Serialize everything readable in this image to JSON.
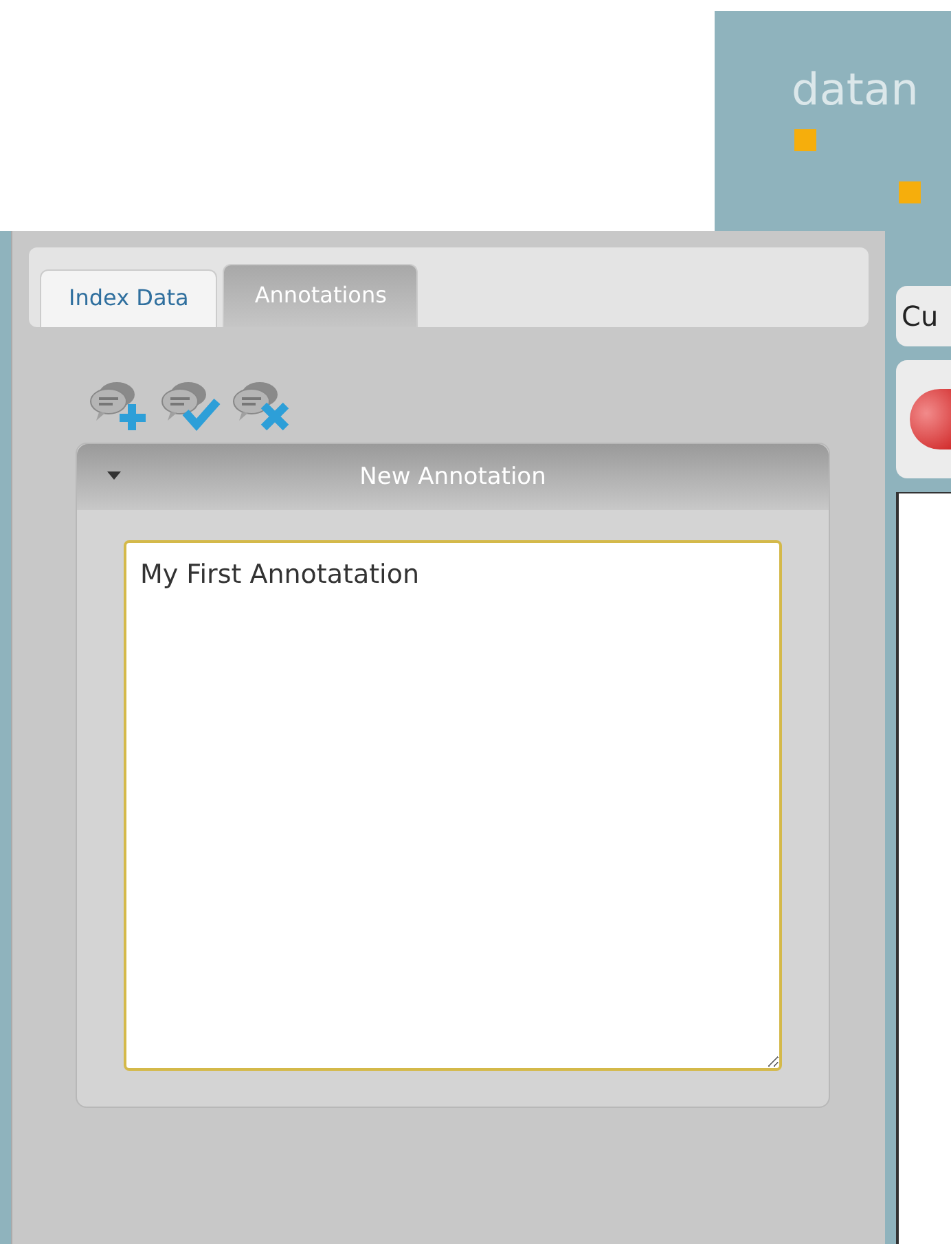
{
  "header": {
    "logo_text": "datan"
  },
  "tabs": [
    {
      "label": "Index Data",
      "selected": false
    },
    {
      "label": "Annotations",
      "selected": true
    }
  ],
  "toolbar": [
    {
      "kind": "add"
    },
    {
      "kind": "accept"
    },
    {
      "kind": "delete"
    }
  ],
  "accordion": {
    "title": "New Annotation",
    "expanded": true,
    "text": "My First Annotatation"
  },
  "side": {
    "label": "Cu"
  }
}
